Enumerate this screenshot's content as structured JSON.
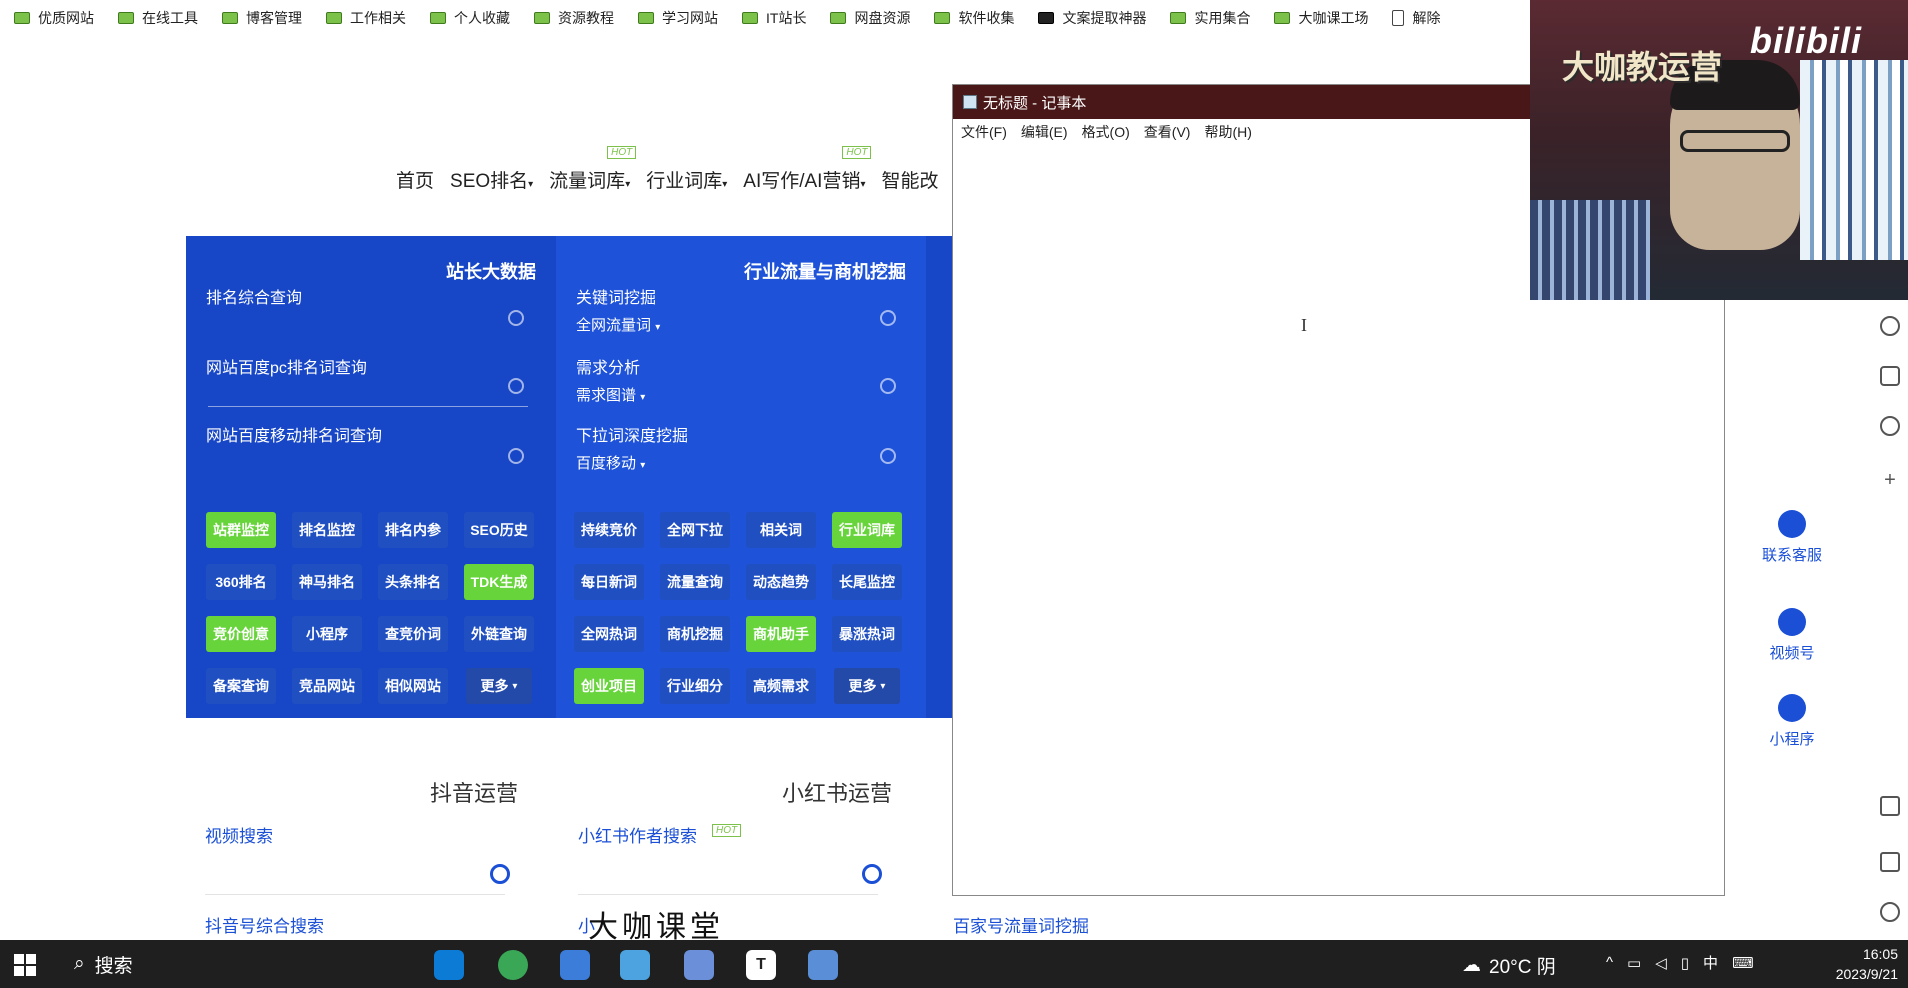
{
  "bookmarks": [
    {
      "label": "优质网站",
      "icon": "folder-icon"
    },
    {
      "label": "在线工具",
      "icon": "folder-icon"
    },
    {
      "label": "博客管理",
      "icon": "folder-icon"
    },
    {
      "label": "工作相关",
      "icon": "folder-icon"
    },
    {
      "label": "个人收藏",
      "icon": "folder-icon"
    },
    {
      "label": "资源教程",
      "icon": "folder-icon"
    },
    {
      "label": "学习网站",
      "icon": "folder-icon"
    },
    {
      "label": "IT站长",
      "icon": "folder-icon"
    },
    {
      "label": "网盘资源",
      "icon": "folder-icon"
    },
    {
      "label": "软件收集",
      "icon": "folder-icon"
    },
    {
      "label": "文案提取神器",
      "icon": "app-icon"
    },
    {
      "label": "实用集合",
      "icon": "folder-icon"
    },
    {
      "label": "大咖课工场",
      "icon": "folder-icon"
    },
    {
      "label": "解除",
      "icon": "page-icon"
    }
  ],
  "site_nav": {
    "items": [
      "首页",
      "SEO排名",
      "流量词库",
      "行业词库",
      "AI写作/AI营销",
      "智能改"
    ],
    "hot_badge": "HOT"
  },
  "panel": {
    "col1": {
      "title": "站长大数据",
      "fields": [
        "排名综合查询",
        "网站百度pc排名词查询",
        "网站百度移动排名词查询"
      ],
      "buttons": [
        [
          "站群监控",
          "排名监控",
          "排名内参",
          "SEO历史"
        ],
        [
          "360排名",
          "神马排名",
          "头条排名",
          "TDK生成"
        ],
        [
          "竞价创意",
          "小程序",
          "查竞价词",
          "外链查询"
        ],
        [
          "备案查询",
          "竞品网站",
          "相似网站",
          "更多"
        ]
      ]
    },
    "col2": {
      "title": "行业流量与商机挖掘",
      "fields": [
        "关键词挖掘",
        "需求分析",
        "下拉词深度挖掘"
      ],
      "dropdowns": [
        "全网流量词",
        "需求图谱",
        "百度移动"
      ],
      "buttons": [
        [
          "持续竞价",
          "全网下拉",
          "相关词",
          "行业词库"
        ],
        [
          "每日新词",
          "流量查询",
          "动态趋势",
          "长尾监控"
        ],
        [
          "全网热词",
          "商机挖掘",
          "商机助手",
          "暴涨热词"
        ],
        [
          "创业项目",
          "行业细分",
          "高频需求",
          "更多"
        ]
      ]
    }
  },
  "sections": {
    "douyin": {
      "title": "抖音运营",
      "link1": "视频搜索",
      "link2": "抖音号综合搜索"
    },
    "xhs": {
      "title": "小红书运营",
      "link1": "小红书作者搜索",
      "link2": "小"
    },
    "baijia": {
      "link": "百家号流量词挖掘"
    }
  },
  "notepad": {
    "title": "无标题 - 记事本",
    "menu": [
      "文件(F)",
      "编辑(E)",
      "格式(O)",
      "查看(V)",
      "帮助(H)"
    ],
    "cursor": "I"
  },
  "webcam": {
    "caption": "大咖教运营",
    "logo": "bilibili"
  },
  "side_float": {
    "items": [
      {
        "label": "联系客服",
        "icon": "headset-icon"
      },
      {
        "label": "视频号",
        "icon": "video-icon"
      },
      {
        "label": "小程序",
        "icon": "miniprogram-icon"
      }
    ]
  },
  "watermark": "大咖课堂",
  "taskbar": {
    "search_label": "搜索",
    "weather": "20°C 阴",
    "ime": "中",
    "time": "16:05",
    "date": "2023/9/21"
  },
  "colors": {
    "panel_blue": "#1a4fd6",
    "accent_green": "#66d43a",
    "notepad_title": "#4a1718"
  }
}
